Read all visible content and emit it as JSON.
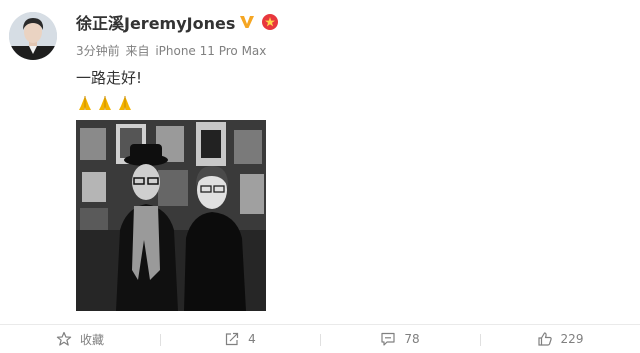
{
  "post": {
    "author": "徐正溪JeremyJones",
    "time": "3分钟前",
    "source_prefix": "来自",
    "source_device": "iPhone 11 Pro Max",
    "text": "一路走好!",
    "emojis": [
      "pray-emoji",
      "pray-emoji",
      "pray-emoji"
    ]
  },
  "actions": {
    "favorite_label": "收藏",
    "share_count": "4",
    "comment_count": "78",
    "like_count": "229"
  },
  "colors": {
    "text_primary": "#333333",
    "text_secondary": "#808080",
    "verified_badge": "#f5a623",
    "flag_badge": "#e8383d"
  }
}
